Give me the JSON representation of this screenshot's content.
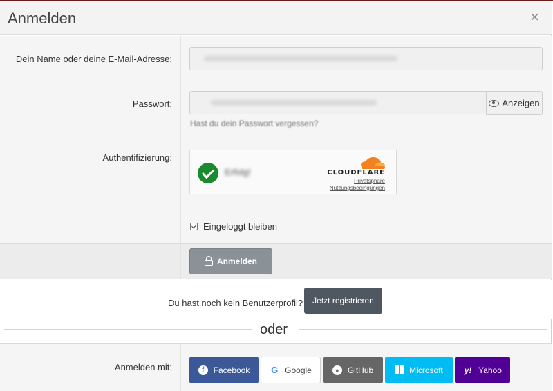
{
  "dialog": {
    "title": "Anmelden",
    "close_label": "×"
  },
  "form": {
    "name_label": "Dein Name oder deine E-Mail-Adresse:",
    "password_label": "Passwort:",
    "show_password_label": "Anzeigen",
    "forgot_password_link": "Hast du dein Passwort vergessen?",
    "auth_label": "Authentifizierung:",
    "remember_label": "Eingeloggt bleiben",
    "submit_label": "Anmelden"
  },
  "turnstile": {
    "status_text": "Erfolg!",
    "brand": "CLOUDFLARE",
    "privacy_link": "Privatsphäre",
    "terms_link": "Nutzungsbedingungen"
  },
  "register": {
    "prompt": "Du hast noch kein Benutzerprofil?",
    "button_label": "Jetzt registrieren"
  },
  "separator": "oder",
  "social": {
    "label": "Anmelden mit:",
    "buttons": [
      {
        "name": "Facebook",
        "color": "#3b5998"
      },
      {
        "name": "Google",
        "color": "#ffffff"
      },
      {
        "name": "GitHub",
        "color": "#666666"
      },
      {
        "name": "Microsoft",
        "color": "#00bcf2"
      },
      {
        "name": "Yahoo",
        "color": "#500095"
      }
    ]
  }
}
